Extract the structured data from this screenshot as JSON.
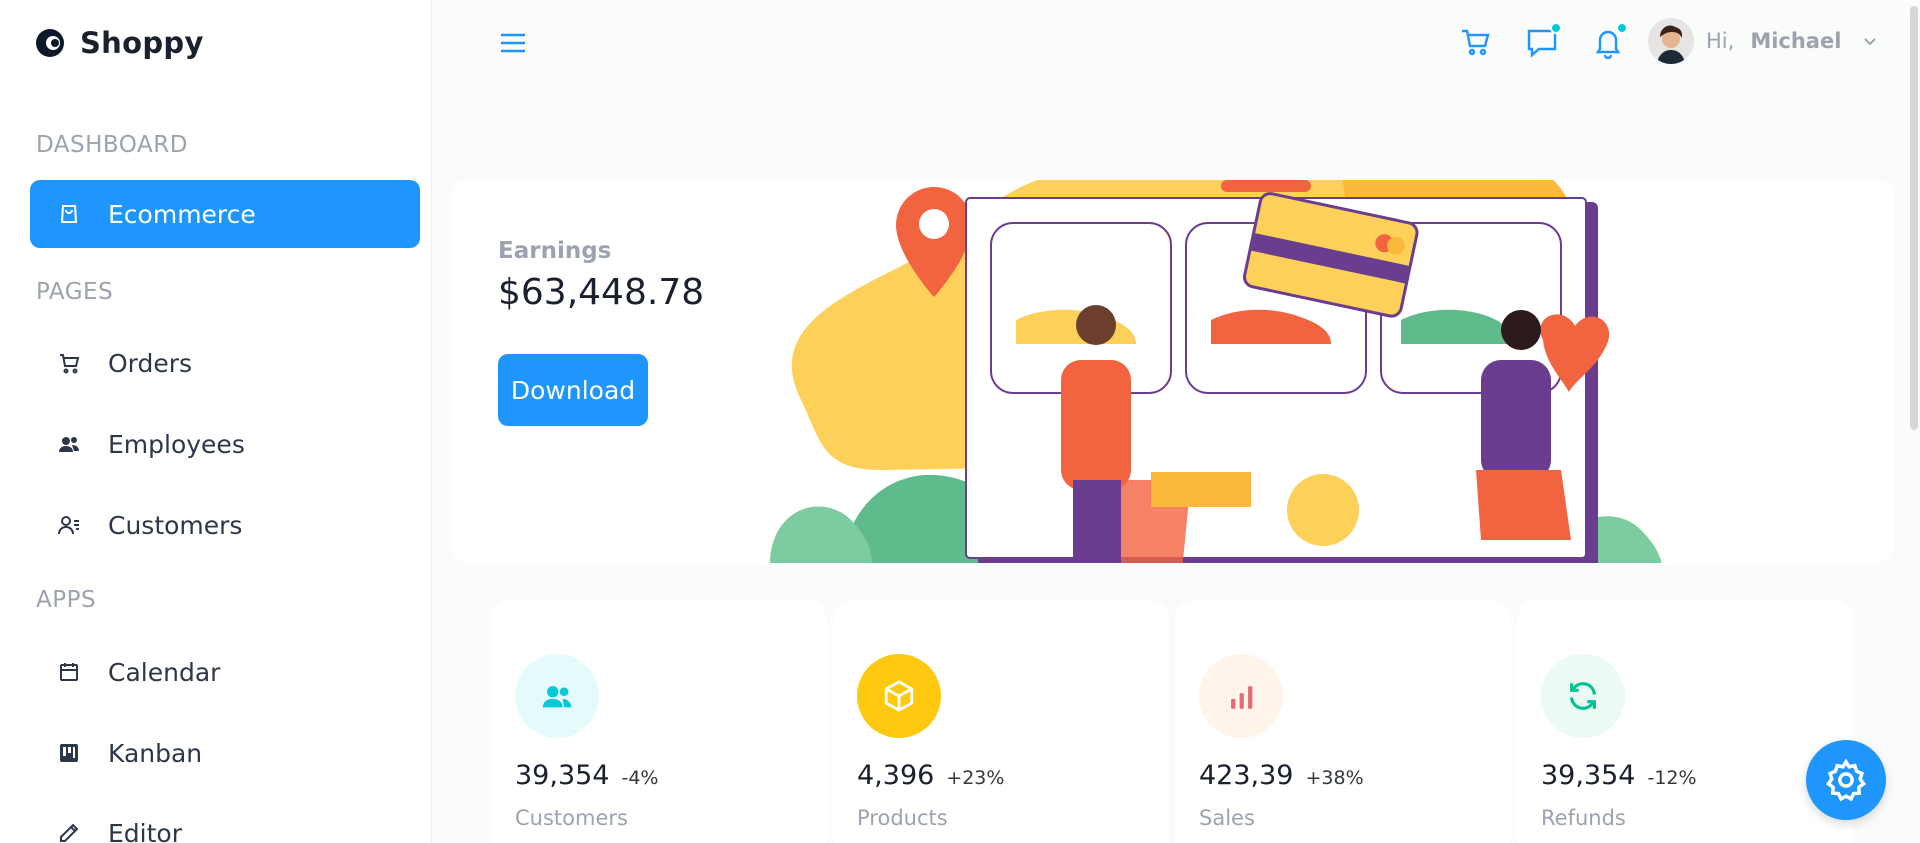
{
  "brand": {
    "name": "Shoppy",
    "accent": "#1e96fc"
  },
  "sidebar": {
    "sections": [
      {
        "title": "DASHBOARD",
        "items": [
          {
            "label": "Ecommerce",
            "icon": "shopping-bag-icon",
            "active": true
          }
        ]
      },
      {
        "title": "PAGES",
        "items": [
          {
            "label": "Orders",
            "icon": "cart-icon"
          },
          {
            "label": "Employees",
            "icon": "people-icon"
          },
          {
            "label": "Customers",
            "icon": "customer-list-icon"
          }
        ]
      },
      {
        "title": "APPS",
        "items": [
          {
            "label": "Calendar",
            "icon": "calendar-icon"
          },
          {
            "label": "Kanban",
            "icon": "kanban-icon"
          },
          {
            "label": "Editor",
            "icon": "edit-icon"
          }
        ]
      }
    ]
  },
  "header": {
    "greeting": "Hi,",
    "user_name": "Michael",
    "icons": [
      "menu-icon",
      "cart-icon",
      "chat-icon",
      "bell-icon"
    ]
  },
  "earnings": {
    "label": "Earnings",
    "value": "$63,448.78",
    "button": "Download"
  },
  "stats": [
    {
      "value": "39,354",
      "change": "-4%",
      "label": "Customers",
      "icon": "customers-icon",
      "icon_color": "#03c9d7",
      "bg": "#e5fafb"
    },
    {
      "value": "4,396",
      "change": "+23%",
      "label": "Products",
      "icon": "box-icon",
      "icon_color": "#ffffff",
      "bg": "#fec90f"
    },
    {
      "value": "423,39",
      "change": "+38%",
      "label": "Sales",
      "icon": "bar-chart-icon",
      "icon_color": "#e46a76",
      "bg": "#fff4ea"
    },
    {
      "value": "39,354",
      "change": "-12%",
      "label": "Refunds",
      "icon": "refresh-icon",
      "icon_color": "#00c292",
      "bg": "#ebfaf2"
    }
  ]
}
